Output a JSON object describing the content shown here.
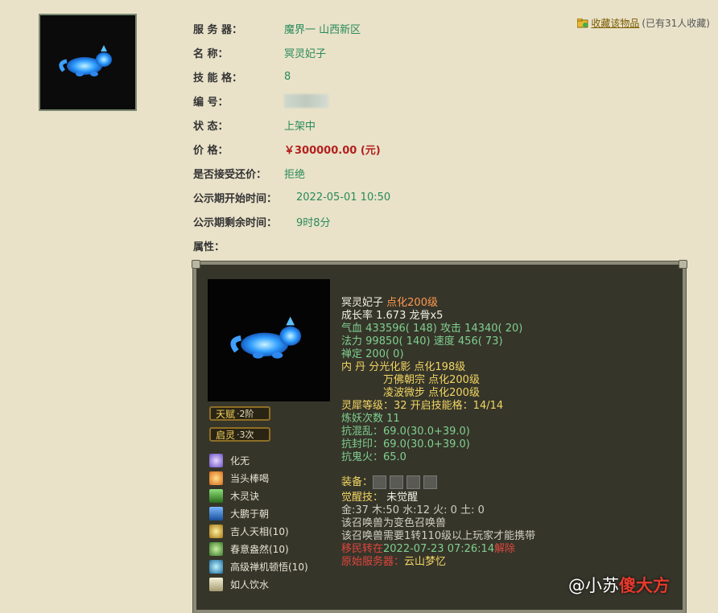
{
  "item": {
    "server_label": "服 务 器：",
    "server_value": "魔界一   山西新区",
    "name_label": "名   称：",
    "name_value": "冥灵妃子",
    "skill_slots_label": "技 能 格：",
    "skill_slots_value": "8",
    "serial_label": "编   号：",
    "status_label": "状   态：",
    "status_value": "上架中",
    "price_label": "价   格：",
    "price_value": "￥300000.00 (元)",
    "bargain_label": "是否接受还价：",
    "bargain_value": "拒绝",
    "public_start_label": "公示期开始时间：",
    "public_start_value": "2022-05-01 10:50",
    "public_remain_label": "公示期剩余时间：",
    "public_remain_value": "9时8分",
    "attr_label": "属性："
  },
  "favorite": {
    "link": "收藏该物品",
    "count": "(已有31人收藏)"
  },
  "panel": {
    "badges": [
      {
        "main": "天赋",
        "sub": "·2阶"
      },
      {
        "main": "启灵",
        "sub": "·3次"
      }
    ],
    "skills": [
      {
        "name": "化无",
        "color": "#6a4fc4"
      },
      {
        "name": "当头棒喝",
        "color": "#d76a1b"
      },
      {
        "name": "木灵诀",
        "color": "#3a8a2a"
      },
      {
        "name": "大鹏于朝",
        "color": "#2a6fb5"
      },
      {
        "name": "吉人天相(10)",
        "color": "#c79b22"
      },
      {
        "name": "春意盎然(10)",
        "color": "#4ea33a"
      },
      {
        "name": "高级禅机顿悟(10)",
        "color": "#2e8fbf"
      },
      {
        "name": "如人饮水",
        "color": "#d0c7a0"
      }
    ],
    "stats": {
      "name": "冥灵妃子",
      "dianhua": "点化200级",
      "growth": "成长率 1.673 龙骨x5",
      "hp_label": "气血",
      "hp_value": "433596( 148)",
      "atk_label": "攻击",
      "atk_value": "14340( 20)",
      "mp_label": "法力",
      "mp_value": "99850( 140)",
      "spd_label": "速度",
      "spd_value": "456( 73)",
      "zen_label": "禅定",
      "zen_value": "200( 0)",
      "neidan_label": "内  丹",
      "neidan_1": "分光化影 点化198级",
      "neidan_2": "万佛朝宗 点化200级",
      "neidan_3": "凌波微步 点化200级",
      "lingxi": "灵犀等级：32 开启技能格：14/14",
      "lianyao": "炼妖次数 11",
      "kang1": "抗混乱：69.0(30.0+39.0)",
      "kang2": "抗封印：69.0(30.0+39.0)",
      "kang3": "抗鬼火：65.0",
      "equip_label": "装备：",
      "awaken_label": "觉醒技：",
      "awaken_value": "未觉醒",
      "elements": "金:37 木:50 水:12 火: 0 土: 0",
      "note1": "该召唤兽为变色召唤兽",
      "note2": "该召唤兽需要1转110级以上玩家才能携带",
      "shift_label": "移民转在",
      "shift_time": "2022-07-23 07:26:14",
      "shift_tail": "解除",
      "origin_label": "原始服务器：",
      "origin_value": "云山梦忆"
    }
  },
  "watermark": {
    "prefix": "@小苏",
    "highlight": "傻大方"
  }
}
